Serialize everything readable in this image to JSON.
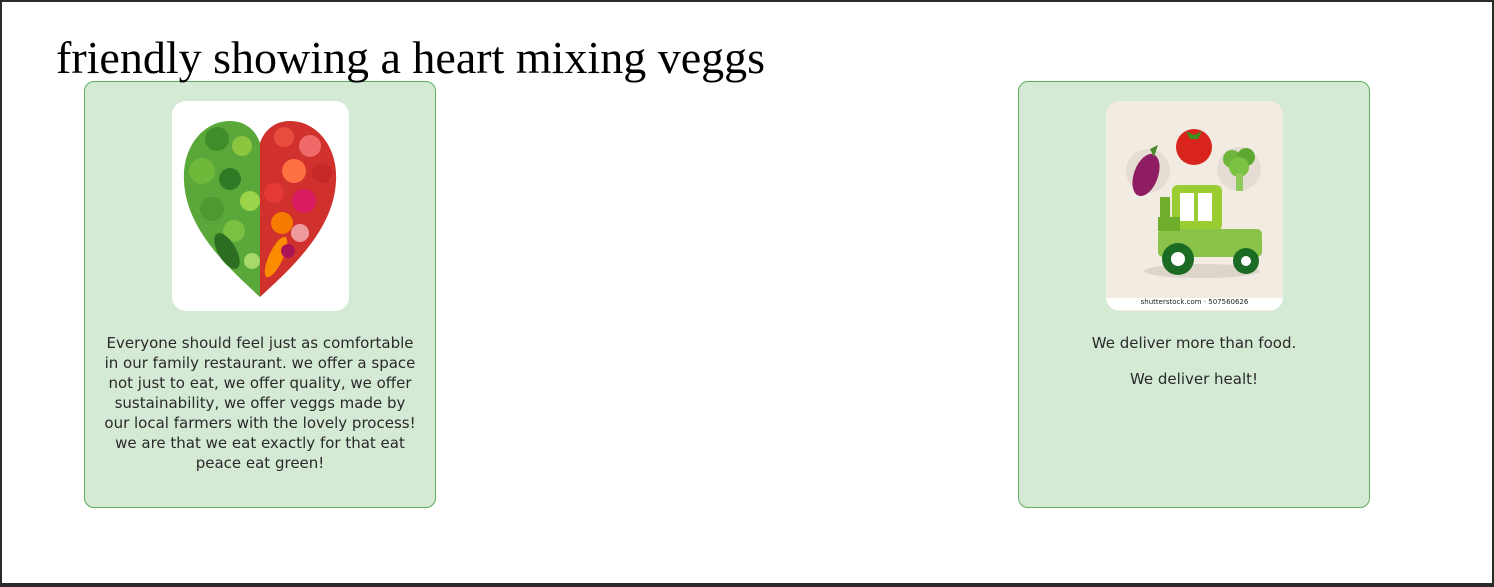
{
  "page": {
    "title": "friendly showing a heart mixing veggs"
  },
  "cards": [
    {
      "image_icon": "vegetable-heart-image",
      "text": "Everyone should feel just as comfortable in our family restaurant. we offer a space not just to eat, we offer quality, we offer sustainability, we offer veggs made by our local farmers with the lovely process! we are that we eat exactly for that eat peace eat green!"
    },
    {
      "image_icon": "vegetable-tractor-image",
      "image_watermark": "shutterstock.com · 507560626",
      "line1": "We deliver more than food.",
      "line2": "We deliver healt!"
    }
  ],
  "colors": {
    "card_background": "#d5ead5",
    "card_border": "#5fae5f"
  }
}
